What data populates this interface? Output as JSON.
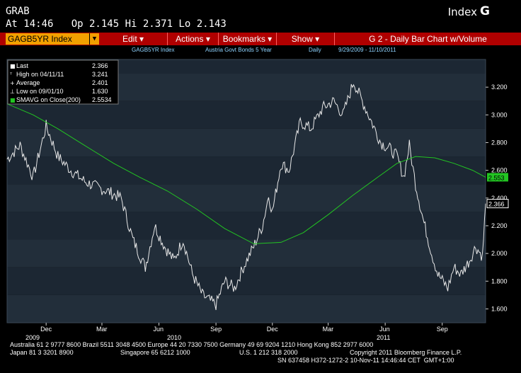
{
  "header": {
    "ticker": "GRAB",
    "quote_line": "At 14:46   Op 2.145 Hi 2.371 Lo 2.143",
    "index_label": "Index",
    "g_icon": "G"
  },
  "menubar": {
    "security": "GAGB5YR Index",
    "items": [
      {
        "label": "Edit"
      },
      {
        "label": "Actions"
      },
      {
        "label": "Bookmarks"
      },
      {
        "label": "Show"
      },
      {
        "label": "G 2 - Daily Bar Chart w/Volume"
      }
    ]
  },
  "infobar": {
    "ticker": "GAGB5YR Index",
    "name": "Austria Govt Bonds 5 Year",
    "period": "Daily",
    "range": "9/29/2009 - 11/10/2011"
  },
  "legend": {
    "rows": [
      {
        "label": "Last",
        "value": "2.366"
      },
      {
        "label": "High on 04/11/11",
        "value": "3.241"
      },
      {
        "label": "Average",
        "value": "2.401"
      },
      {
        "label": "Low on 09/01/10",
        "value": "1.630"
      },
      {
        "label": "SMAVG on Close(200)",
        "value": "2.5534"
      }
    ]
  },
  "colors": {
    "price": "#e8e8e8",
    "smavg": "#22c422",
    "menu": "#b00000",
    "security_field": "#f2a000",
    "info_text": "#8fd3ff"
  },
  "chart_data": {
    "type": "line",
    "ylim": [
      1.5,
      3.4
    ],
    "y_ticks": [
      "3.200",
      "3.000",
      "2.800",
      "2.600",
      "2.400",
      "2.200",
      "2.000",
      "1.800",
      "1.600"
    ],
    "x_month_labels": [
      "Dec",
      "Mar",
      "Jun",
      "Sep",
      "Dec",
      "Mar",
      "Jun",
      "Sep"
    ],
    "x_year_labels": [
      "2009",
      "2010",
      "2011"
    ],
    "last_label": "2.366",
    "smavg_label": "2.553",
    "series": [
      {
        "name": "Last",
        "x": [
          "2009-09-29",
          "2009-10-20",
          "2009-11-10",
          "2009-12-01",
          "2009-12-20",
          "2010-01-10",
          "2010-02-01",
          "2010-02-20",
          "2010-03-10",
          "2010-04-01",
          "2010-04-20",
          "2010-05-10",
          "2010-05-25",
          "2010-06-10",
          "2010-06-25",
          "2010-07-10",
          "2010-07-25",
          "2010-08-10",
          "2010-08-25",
          "2010-09-01",
          "2010-09-15",
          "2010-10-01",
          "2010-10-15",
          "2010-11-01",
          "2010-11-15",
          "2010-11-25",
          "2010-12-01",
          "2010-12-15",
          "2010-12-28",
          "2011-01-15",
          "2011-02-01",
          "2011-02-20",
          "2011-03-10",
          "2011-03-25",
          "2011-04-11",
          "2011-04-25",
          "2011-05-10",
          "2011-05-25",
          "2011-06-10",
          "2011-06-20",
          "2011-07-01",
          "2011-07-10",
          "2011-07-20",
          "2011-08-01",
          "2011-08-15",
          "2011-08-25",
          "2011-09-10",
          "2011-09-20",
          "2011-10-01",
          "2011-10-15",
          "2011-10-25",
          "2011-11-05",
          "2011-11-10"
        ],
        "values": [
          2.68,
          2.78,
          2.55,
          2.92,
          2.7,
          2.6,
          2.52,
          2.48,
          2.45,
          2.4,
          2.1,
          1.9,
          2.2,
          2.05,
          1.95,
          2.1,
          1.85,
          1.7,
          1.65,
          1.63,
          1.8,
          1.75,
          1.9,
          2.05,
          2.2,
          2.42,
          2.3,
          2.65,
          2.6,
          2.95,
          2.9,
          3.05,
          3.1,
          3.0,
          3.24,
          3.1,
          2.95,
          2.8,
          2.75,
          2.7,
          2.55,
          2.78,
          2.5,
          2.25,
          2.0,
          1.85,
          1.75,
          1.9,
          1.85,
          1.95,
          2.05,
          1.98,
          2.36
        ]
      },
      {
        "name": "SMAVG on Close(200)",
        "x": [
          "2009-09-29",
          "2009-11-10",
          "2009-12-20",
          "2010-02-01",
          "2010-03-20",
          "2010-05-01",
          "2010-06-15",
          "2010-08-01",
          "2010-09-15",
          "2010-11-01",
          "2010-12-15",
          "2011-01-20",
          "2011-03-01",
          "2011-04-10",
          "2011-05-20",
          "2011-06-20",
          "2011-07-20",
          "2011-08-20",
          "2011-09-20",
          "2011-10-20",
          "2011-11-10"
        ],
        "values": [
          3.08,
          3.0,
          2.9,
          2.78,
          2.65,
          2.55,
          2.45,
          2.32,
          2.18,
          2.07,
          2.08,
          2.15,
          2.28,
          2.42,
          2.55,
          2.65,
          2.7,
          2.69,
          2.65,
          2.6,
          2.55
        ]
      }
    ]
  },
  "footer": {
    "line1": "Australia 61 2 9777 8600 Brazil 5511 3048 4500 Europe 44 20 7330 7500 Germany 49 69 9204 1210 Hong Kong 852 2977 6000",
    "line2a": "Japan 81 3 3201 8900",
    "line2b": "Singapore 65 6212 1000",
    "line2c": "U.S. 1 212 318 2000",
    "line2d": "Copyright 2011 Bloomberg Finance L.P.",
    "line3": "SN 637458 H372-1272-2 10-Nov-11 14:46:44 CET  GMT+1:00"
  }
}
